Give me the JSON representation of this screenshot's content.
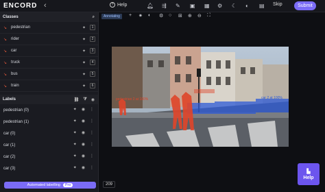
{
  "app": {
    "logo": "ENCORD",
    "back_icon": "chevron-left-icon"
  },
  "header": {
    "help_label": "Help",
    "skip_label": "Skip",
    "submit_label": "Submit",
    "icons": [
      "bell-icon",
      "share-icon",
      "pen-icon",
      "save-icon",
      "grid-icon",
      "gear-icon",
      "moon-icon",
      "docs-icon",
      "file-icon"
    ]
  },
  "sidebar": {
    "classes_title": "Classes",
    "classes": [
      {
        "name": "pedestrian",
        "hotkey": "1"
      },
      {
        "name": "rider",
        "hotkey": "2"
      },
      {
        "name": "car",
        "hotkey": "3"
      },
      {
        "name": "truck",
        "hotkey": "4"
      },
      {
        "name": "bus",
        "hotkey": "5"
      },
      {
        "name": "train",
        "hotkey": "6"
      }
    ],
    "labels_title": "Labels",
    "labels": [
      {
        "name": "pedestrian (0)"
      },
      {
        "name": "pedestrian (1)"
      },
      {
        "name": "car (0)"
      },
      {
        "name": "car (1)"
      },
      {
        "name": "car (2)"
      },
      {
        "name": "car (3)"
      }
    ],
    "auto_label": "Automated labelling",
    "pro_badge": "Pro"
  },
  "toolbar": {
    "mode_tag": "Annotating"
  },
  "viewer": {
    "frame_number": "209",
    "annotations": [
      {
        "text": "pedestrian 2 at 100%"
      },
      {
        "text": "car 2 at 100%"
      }
    ]
  },
  "help_float": {
    "label": "Help"
  },
  "colors": {
    "accent": "#7b6cf6",
    "polygon": "#e0452a",
    "car_mask": "#2e5bd8"
  }
}
